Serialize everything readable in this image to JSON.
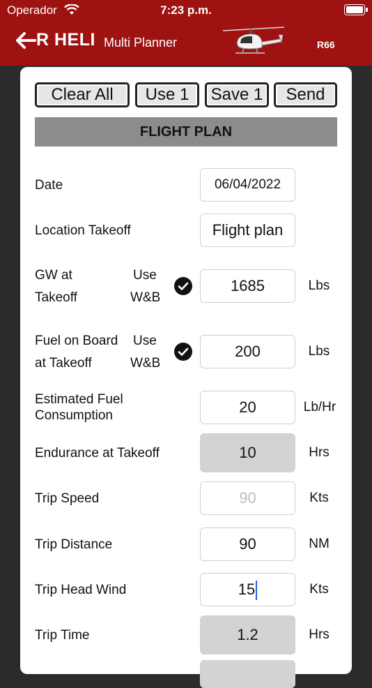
{
  "status_bar": {
    "carrier": "Operador",
    "time": "7:23 p.m."
  },
  "header": {
    "brand": "R HELI",
    "subtitle": "Multi Planner",
    "model": "R66",
    "icons": [
      "back-arrow-icon",
      "helicopter-icon"
    ]
  },
  "toolbar": {
    "clear_all": "Clear All",
    "use_1": "Use 1",
    "save_1": "Save 1",
    "send": "Send"
  },
  "section_title": "FLIGHT PLAN",
  "fields": {
    "date": {
      "label": "Date",
      "value": "06/04/2022"
    },
    "location_takeoff": {
      "label": "Location Takeoff",
      "value": "Flight plan"
    },
    "gw_takeoff": {
      "label_line1": "GW at",
      "label_line2": "Takeoff",
      "use_line1": "Use",
      "use_line2": "W&B",
      "value": "1685",
      "unit": "Lbs"
    },
    "fuel_on_board": {
      "label_line1": "Fuel on Board",
      "label_line2": "at Takeoff",
      "use_line1": "Use",
      "use_line2": "W&B",
      "value": "200",
      "unit": "Lbs"
    },
    "est_fuel_consumption": {
      "label_line1": "Estimated Fuel",
      "label_line2": "Consumption",
      "value": "20",
      "unit": "Lb/Hr"
    },
    "endurance_takeoff": {
      "label": "Endurance at Takeoff",
      "value": "10",
      "unit": "Hrs"
    },
    "trip_speed": {
      "label": "Trip Speed",
      "value": "90",
      "unit": "Kts"
    },
    "trip_distance": {
      "label": "Trip Distance",
      "value": "90",
      "unit": "NM"
    },
    "trip_head_wind": {
      "label": "Trip Head Wind",
      "value": "15",
      "unit": "Kts"
    },
    "trip_time": {
      "label": "Trip Time",
      "value": "1.2",
      "unit": "Hrs"
    }
  },
  "colors": {
    "header_bg": "#9e1212",
    "section_title_bg": "#8c8c8c",
    "readonly_field_bg": "#d3d3d3",
    "cursor": "#2c5bea"
  }
}
